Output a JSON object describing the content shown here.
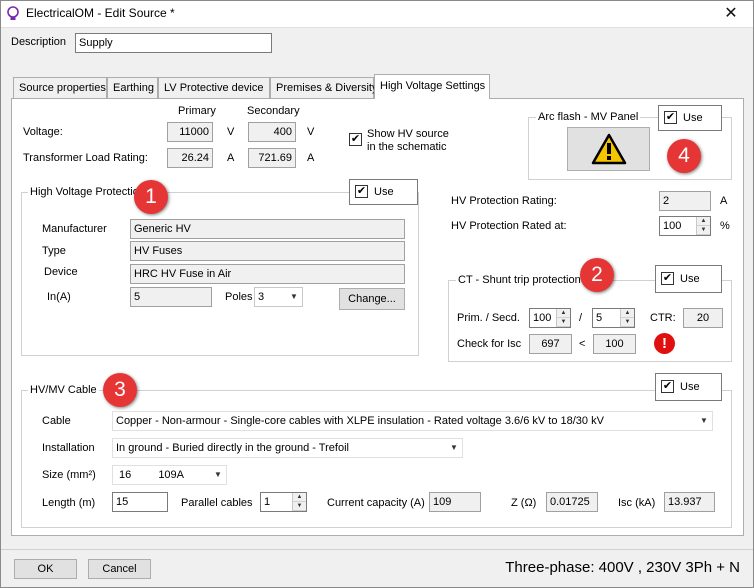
{
  "window": {
    "title": "ElectricalOM - Edit Source *",
    "close_glyph": "✕"
  },
  "description": {
    "label": "Description",
    "value": "Supply"
  },
  "tabs": [
    {
      "label": "Source properties"
    },
    {
      "label": "Earthing"
    },
    {
      "label": "LV Protective device"
    },
    {
      "label": "Premises & Diversity"
    },
    {
      "label": "High Voltage Settings"
    }
  ],
  "hv": {
    "primary_header": "Primary",
    "secondary_header": "Secondary",
    "voltage_label": "Voltage:",
    "voltage_primary": "11000",
    "voltage_primary_unit": "V",
    "voltage_secondary": "400",
    "voltage_secondary_unit": "V",
    "tlr_label": "Transformer Load Rating:",
    "tlr_primary": "26.24",
    "tlr_primary_unit": "A",
    "tlr_secondary": "721.69",
    "tlr_secondary_unit": "A",
    "show_hv_line1": "Show HV source",
    "show_hv_line2": "in the schematic",
    "show_hv_checked": "✔"
  },
  "arc_flash": {
    "label": "Arc flash - MV Panel",
    "use_label": "Use",
    "use_checked": "✔",
    "badge": "4"
  },
  "hv_protection": {
    "label": "High Voltage Protection",
    "use_label": "Use",
    "use_checked": "✔",
    "badge": "1",
    "manufacturer_label": "Manufacturer",
    "manufacturer": "Generic HV",
    "type_label": "Type",
    "type": "HV Fuses",
    "device_label": "Device",
    "device": "HRC HV Fuse in Air",
    "in_label": "In(A)",
    "in_value": "5",
    "poles_label": "Poles",
    "poles_value": "3",
    "change_button": "Change..."
  },
  "hv_rating": {
    "rating_label": "HV Protection Rating:",
    "rating_value": "2",
    "rating_unit": "A",
    "rated_at_label": "HV Protection Rated at:",
    "rated_at_value": "100",
    "rated_at_unit": "%"
  },
  "ct": {
    "label": "CT - Shunt trip protection",
    "use_label": "Use",
    "use_checked": "✔",
    "badge": "2",
    "prim_secd_label": "Prim. / Secd.",
    "prim_value": "100",
    "slash": "/",
    "secd_value": "5",
    "ctr_label": "CTR:",
    "ctr_value": "20",
    "isc_label": "Check for Isc",
    "isc_value": "697",
    "lt": "<",
    "isc_limit": "100",
    "alert_glyph": "!"
  },
  "cable": {
    "label": "HV/MV Cable",
    "use_label": "Use",
    "use_checked": "✔",
    "badge": "3",
    "cable_label": "Cable",
    "cable_value": "Copper - Non-armour - Single-core cables with XLPE insulation - Rated voltage 3.6/6 kV to 18/30 kV",
    "installation_label": "Installation",
    "installation_value": "In ground - Buried directly in the ground - Trefoil",
    "size_label": "Size (mm²)",
    "size_value": "16",
    "size_rating": "109A",
    "length_label": "Length (m)",
    "length_value": "15",
    "parallel_label": "Parallel cables",
    "parallel_value": "1",
    "current_capacity_label": "Current capacity (A)",
    "current_capacity_value": "109",
    "z_label": "Z (Ω)",
    "z_value": "0.01725",
    "isc_label": "Isc (kA)",
    "isc_value": "13.937"
  },
  "footer": {
    "ok": "OK",
    "cancel": "Cancel",
    "status": "Three-phase: 400V , 230V 3Ph + N"
  },
  "colors": {
    "badge": "#e53535",
    "alert": "#e01010",
    "warning": "#f5c400"
  }
}
